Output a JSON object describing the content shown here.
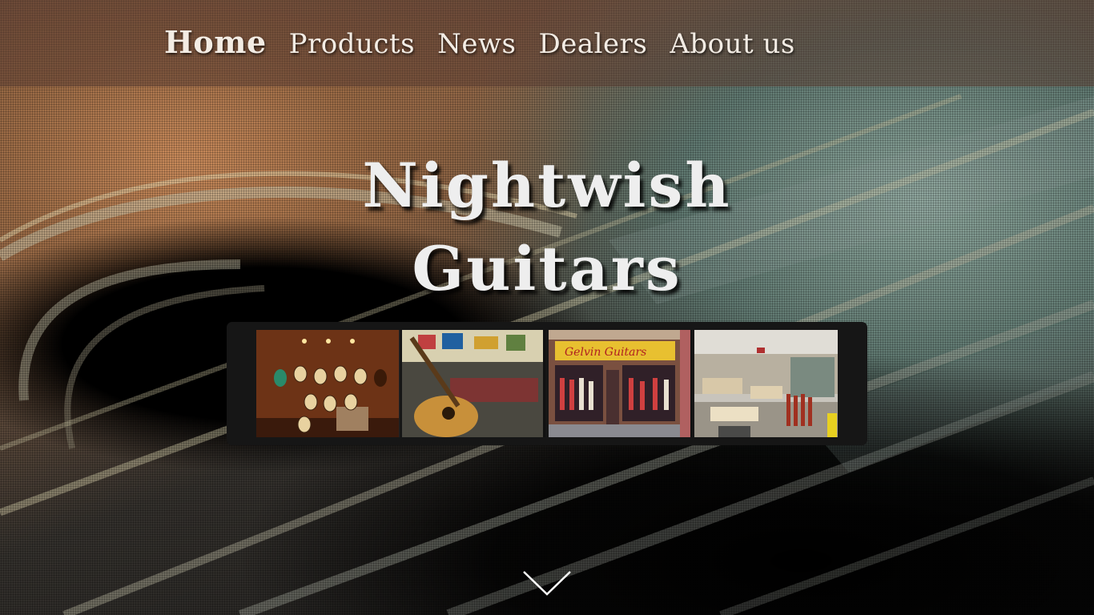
{
  "nav": {
    "items": [
      {
        "label": "Home",
        "active": true
      },
      {
        "label": "Products",
        "active": false
      },
      {
        "label": "News",
        "active": false
      },
      {
        "label": "Dealers",
        "active": false
      },
      {
        "label": "About us",
        "active": false
      }
    ]
  },
  "hero": {
    "title_line1": "Nightwish",
    "title_line2": "Guitars"
  },
  "gallery": {
    "images": [
      {
        "name": "guitar-wall-photo"
      },
      {
        "name": "acoustic-guitar-workshop-photo"
      },
      {
        "name": "guitar-storefront-photo",
        "sign_text": "Gelvin Guitars"
      },
      {
        "name": "guitar-factory-floor-photo"
      }
    ]
  },
  "scroll": {
    "icon": "chevron-down-icon"
  },
  "colors": {
    "nav_bar": "#5a3c32",
    "title_text": "#eeeeee",
    "gallery_frame": "#161616"
  }
}
